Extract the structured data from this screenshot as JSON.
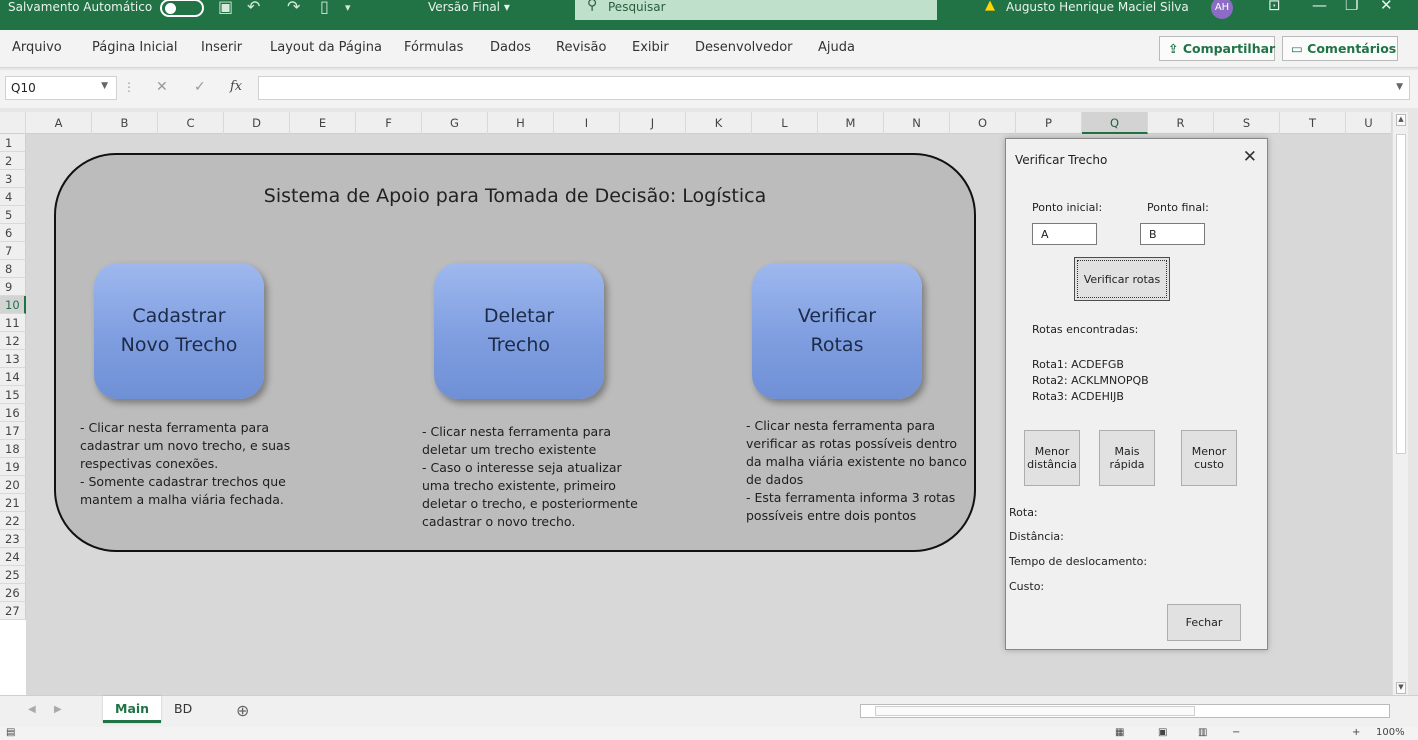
{
  "titlebar": {
    "autosave_label": "Salvamento Automático",
    "doc_title": "Versão Final ▾",
    "search_placeholder": "Pesquisar",
    "user_name": "Augusto Henrique Maciel Silva",
    "user_initials": "AH"
  },
  "ribbon": {
    "tabs": [
      "Arquivo",
      "Página Inicial",
      "Inserir",
      "Layout da Página",
      "Fórmulas",
      "Dados",
      "Revisão",
      "Exibir",
      "Desenvolvedor",
      "Ajuda"
    ],
    "share_label": "Compartilhar",
    "comments_label": "Comentários"
  },
  "formula_bar": {
    "name_box": "Q10",
    "fx_label": "fx",
    "formula_value": ""
  },
  "grid": {
    "columns": [
      "A",
      "B",
      "C",
      "D",
      "E",
      "F",
      "G",
      "H",
      "I",
      "J",
      "K",
      "L",
      "M",
      "N",
      "O",
      "P",
      "Q",
      "R",
      "S",
      "T",
      "U"
    ],
    "selected_column": "Q",
    "rows": [
      "1",
      "2",
      "3",
      "4",
      "5",
      "6",
      "7",
      "8",
      "9",
      "10",
      "11",
      "12",
      "13",
      "14",
      "15",
      "16",
      "17",
      "18",
      "19",
      "20",
      "21",
      "22",
      "23",
      "24",
      "25",
      "26",
      "27"
    ],
    "selected_row": "10"
  },
  "panel": {
    "title": "Sistema de Apoio para Tomada de Decisão: Logística",
    "buttons": [
      {
        "label": "Cadastrar\nNovo Trecho"
      },
      {
        "label": "Deletar\nTrecho"
      },
      {
        "label": "Verificar\nRotas"
      }
    ],
    "descriptions": [
      "- Clicar nesta ferramenta para\ncadastrar um novo trecho, e suas\nrespectivas conexões.\n- Somente cadastrar trechos que\nmantem a malha viária fechada.",
      "- Clicar nesta ferramenta para\ndeletar um trecho existente\n- Caso o interesse seja atualizar\numa trecho existente, primeiro\ndeletar o trecho, e posteriormente\ncadastrar o novo trecho.",
      "- Clicar nesta ferramenta para\nverificar as rotas possíveis dentro\nda malha viária existente no banco\nde dados\n- Esta ferramenta informa 3 rotas\npossíveis entre dois pontos"
    ]
  },
  "dialog": {
    "title": "Verificar Trecho",
    "start_label": "Ponto inicial:",
    "start_value": "A",
    "end_label": "Ponto final:",
    "end_value": "B",
    "check_button": "Verificar rotas",
    "routes_header": "Rotas encontradas:",
    "routes": [
      "Rota1: ACDEFGB",
      "Rota2: ACKLMNOPQB",
      "Rota3: ACDEHIJB"
    ],
    "btn_shortest": "Menor\ndistância",
    "btn_fastest": "Mais\nrápida",
    "btn_cheapest": "Menor\ncusto",
    "result_route": "Rota:",
    "result_distance": "Distância:",
    "result_time": "Tempo de deslocamento:",
    "result_cost": "Custo:",
    "close_button": "Fechar"
  },
  "sheets": {
    "tabs": [
      "Main",
      "BD"
    ],
    "active": "Main"
  },
  "status": {
    "zoom": "100%"
  }
}
